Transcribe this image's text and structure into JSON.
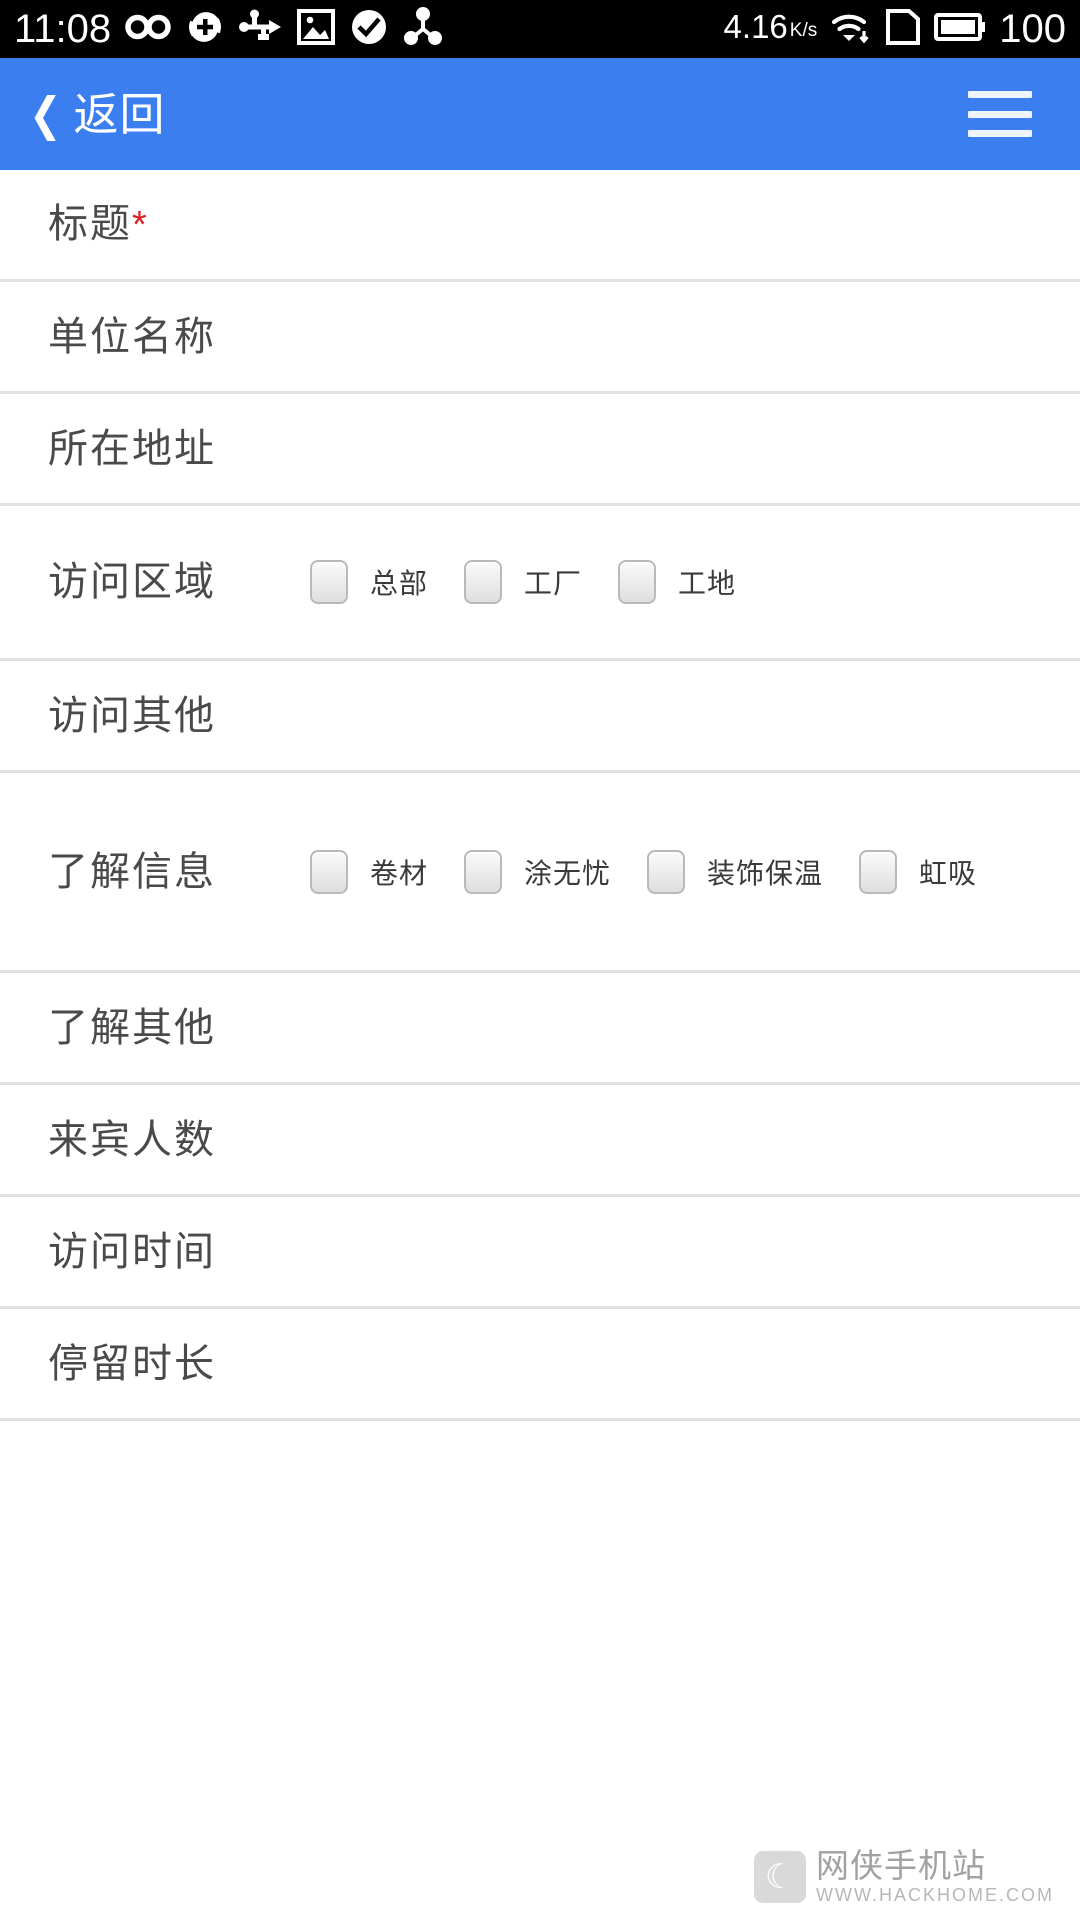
{
  "status_bar": {
    "time": "11:08",
    "network_speed": "4.16",
    "network_speed_unit_top": "K",
    "network_speed_unit_bottom": "s",
    "battery_percent": "100",
    "icons": [
      "infinity-icon",
      "sync-add-icon",
      "usb-icon",
      "image-icon",
      "check-circle-icon",
      "share-nodes-icon",
      "wifi-download-icon",
      "sim-card-icon",
      "battery-icon"
    ]
  },
  "appbar": {
    "back_label": "返回",
    "back_chevron": "❮",
    "menu_icon": "hamburger-menu-icon",
    "background_color": "#3b7ef0"
  },
  "form": {
    "required_mark": "*",
    "rows": [
      {
        "label": "标题",
        "required": true,
        "options": []
      },
      {
        "label": "单位名称",
        "required": false,
        "options": []
      },
      {
        "label": "所在地址",
        "required": false,
        "options": []
      },
      {
        "label": "访问区域",
        "required": false,
        "options": [
          "总部",
          "工厂",
          "工地"
        ]
      },
      {
        "label": "访问其他",
        "required": false,
        "options": []
      },
      {
        "label": "了解信息",
        "required": false,
        "options": [
          "卷材",
          "涂无忧",
          "装饰保温",
          "虹吸"
        ]
      },
      {
        "label": "了解其他",
        "required": false,
        "options": []
      },
      {
        "label": "来宾人数",
        "required": false,
        "options": []
      },
      {
        "label": "访问时间",
        "required": false,
        "options": []
      },
      {
        "label": "停留时长",
        "required": false,
        "options": []
      }
    ]
  },
  "watermark": {
    "title": "网侠手机站",
    "url": "WWW.HACKHOME.COM",
    "logo_glyph": "☾"
  }
}
